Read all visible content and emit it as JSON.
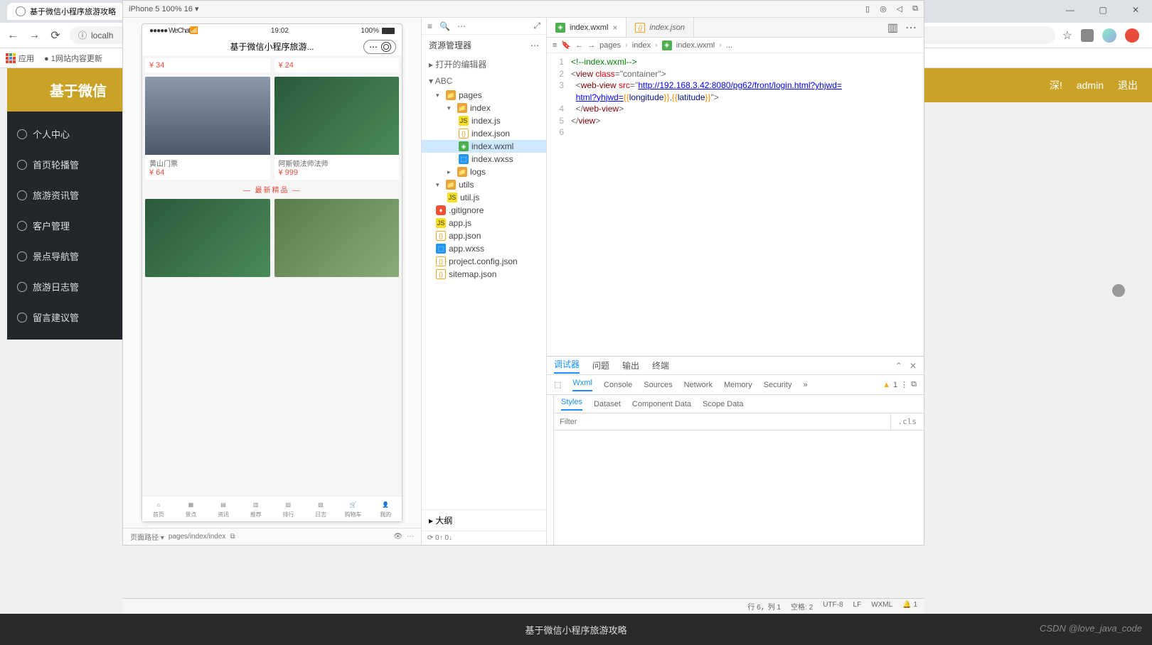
{
  "browser": {
    "tab_title": "基于微信小程序旅游攻略",
    "url": "localh",
    "bookmark_apps": "应用",
    "bookmark_item1": "1网站内容更新",
    "toolbar_icons": {
      "star": "☆"
    }
  },
  "admin": {
    "title": "基于微信",
    "topbar_text": "深!",
    "topbar_admin": "admin",
    "topbar_logout": "退出",
    "menu": [
      "个人中心",
      "首页轮播管",
      "旅游资讯管",
      "客户管理",
      "景点导航管",
      "旅游日志管",
      "留言建议管"
    ]
  },
  "devtools": {
    "device_label": "iPhone 5 100% 16 ▾",
    "simulator": {
      "status_left": "●●●●● WeChat",
      "status_time": "19:02",
      "status_right_pct": "100%",
      "title": "基于微信小程序旅游...",
      "price1": "¥ 34",
      "price2": "¥ 24",
      "prod1_name": "黄山门票",
      "prod1_price": "¥ 64",
      "prod2_name": "阿斯顿法师法师",
      "prod2_price": "¥ 999",
      "section": "— 最新精品 —",
      "tabs": [
        "首页",
        "景点",
        "资讯",
        "推荐",
        "排行",
        "日志",
        "购物车",
        "我的"
      ],
      "footer_label": "页面路径 ▾",
      "footer_path": "pages/index/index"
    },
    "tree": {
      "header": "资源管理器",
      "open_editors": "打开的编辑器",
      "root": "ABC",
      "nodes": {
        "pages": "pages",
        "index": "index",
        "indexjs": "index.js",
        "indexjson": "index.json",
        "indexwxml": "index.wxml",
        "indexwxss": "index.wxss",
        "logs": "logs",
        "utils": "utils",
        "utiljs": "util.js",
        "gitignore": ".gitignore",
        "appjs": "app.js",
        "appjson": "app.json",
        "appwxss": "app.wxss",
        "projectconfig": "project.config.json",
        "sitemap": "sitemap.json"
      },
      "outline": "大纲",
      "status_sync": "⟳ 0↑ 0↓"
    },
    "editor": {
      "tabs": [
        {
          "name": "index.wxml",
          "active": true
        },
        {
          "name": "index.json",
          "active": false
        }
      ],
      "breadcrumb": [
        "pages",
        "index",
        "index.wxml",
        "..."
      ],
      "code": {
        "l1_comment": "<!--index.wxml-->",
        "l2": "<view class=\"container\">",
        "l3a": "  <web-view src=\"",
        "l3url": "http://192.168.3.42:8080/pg62/front/login.html?yhjwd=",
        "l3b_open": "{{",
        "l3var1": "longitude",
        "l3mid": "}},{{",
        "l3var2": "latitude",
        "l3close": "}}",
        "l3end": "\">",
        "l4": "  </web-view>",
        "l5": "</view>"
      }
    },
    "debugger": {
      "main_tabs": [
        "调试器",
        "问题",
        "输出",
        "终端"
      ],
      "tools": [
        "Wxml",
        "Console",
        "Sources",
        "Network",
        "Memory",
        "Security"
      ],
      "warn_count": "1",
      "sub_tabs": [
        "Styles",
        "Dataset",
        "Component Data",
        "Scope Data"
      ],
      "filter_placeholder": "Filter",
      "cls": ".cls"
    },
    "statusbar": {
      "pos": "行 6，列 1",
      "spaces": "空格: 2",
      "enc": "UTF-8",
      "eol": "LF",
      "lang": "WXML",
      "bell": "1"
    }
  },
  "caption": "基于微信小程序旅游攻略",
  "watermark": "CSDN @love_java_code"
}
